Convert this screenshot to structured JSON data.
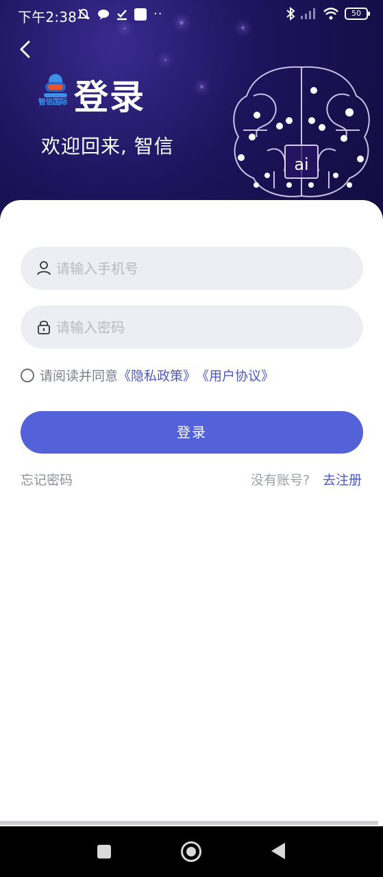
{
  "status_bar": {
    "time": "下午2:38",
    "battery_level": "50",
    "icons": [
      "mute-icon",
      "chat-icon",
      "download-done-icon",
      "app-icon",
      "more-dots-icon",
      "bluetooth-icon",
      "signal-icon",
      "wifi-icon",
      "battery-icon"
    ]
  },
  "header": {
    "title": "登录",
    "subtitle": "欢迎回来, 智信",
    "logo_text": "智信国际",
    "brain_label": "ai"
  },
  "form": {
    "phone_placeholder": "请输入手机号",
    "password_placeholder": "请输入密码",
    "agree_prefix": "请阅读并同意",
    "privacy_link": "《隐私政策》",
    "user_agreement_link": "《用户协议》",
    "login_label": "登录",
    "forgot_label": "忘记密码",
    "no_account_label": "没有账号?",
    "register_label": "去注册"
  },
  "colors": {
    "accent": "#5462d9",
    "link": "#4b58c9",
    "header_bg": "#1c145b"
  }
}
